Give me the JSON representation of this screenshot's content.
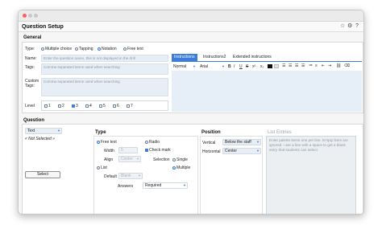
{
  "window": {
    "title": "Question Setup"
  },
  "header_icons": [
    "star-icon",
    "settings-icon",
    "help-icon"
  ],
  "general": {
    "title": "General",
    "type": {
      "label": "Type:",
      "options": [
        {
          "label": "Multiple choice",
          "selected": false
        },
        {
          "label": "Tapping",
          "selected": false
        },
        {
          "label": "Notation",
          "selected": true
        },
        {
          "label": "Free text",
          "selected": false
        }
      ]
    },
    "name": {
      "label": "Name:",
      "placeholder": "Enter the question name, this is not displayed in the drill"
    },
    "tags": {
      "label": "Tags:",
      "placeholder": "Comma separated items used when searching"
    },
    "custom_tags": {
      "label_line1": "Custom",
      "label_line2": "Tags:",
      "placeholder": "Comma separated items used when searching"
    },
    "level": {
      "label": "Level",
      "options": [
        "1",
        "2",
        "3",
        "4",
        "5",
        "6",
        "7"
      ],
      "checked": [
        false,
        false,
        true,
        false,
        false,
        false,
        false
      ]
    }
  },
  "instructions": {
    "tabs": [
      "Instructions",
      "Instructions2",
      "Extended instructions"
    ],
    "active_tab": 0,
    "toolbar": {
      "style": "Normal",
      "font": "Arial",
      "format": [
        "B",
        "I",
        "U",
        "S",
        "x²",
        "x₂"
      ]
    }
  },
  "question": {
    "title": "Question",
    "type_select": "Text",
    "not_selected": "« Not Selected »",
    "select_button": "Select"
  },
  "type_section": {
    "title": "Type",
    "free_text": {
      "label": "Free text",
      "selected": true
    },
    "radio": {
      "label": "Radio",
      "selected": false
    },
    "width": {
      "label": "Width",
      "value": "5"
    },
    "check_mark": {
      "label": "Check mark",
      "checked": true
    },
    "align": {
      "label": "Align",
      "value": "Center"
    },
    "selection": {
      "label": "Selection",
      "single": "Single",
      "multiple": "Multiple",
      "multiple_selected": true
    },
    "list": {
      "label": "List",
      "selected": false
    },
    "default": {
      "label": "Default",
      "value": "Blank"
    },
    "answers": {
      "label": "Answers",
      "value": "Required"
    }
  },
  "position": {
    "title": "Position",
    "vertical": {
      "label": "Vertical",
      "value": "Below the staff"
    },
    "horizontal": {
      "label": "Horizontal",
      "value": "Center"
    }
  },
  "list_entries": {
    "title": "List Entries",
    "placeholder": "Enter palette items one per line.  Empty lines are ignored - use a line with a space to get a blank entry that students can select."
  },
  "colors": {
    "accent": "#3b7dd8",
    "field_bg": "#e8eef6",
    "close": "#fc5f57"
  }
}
